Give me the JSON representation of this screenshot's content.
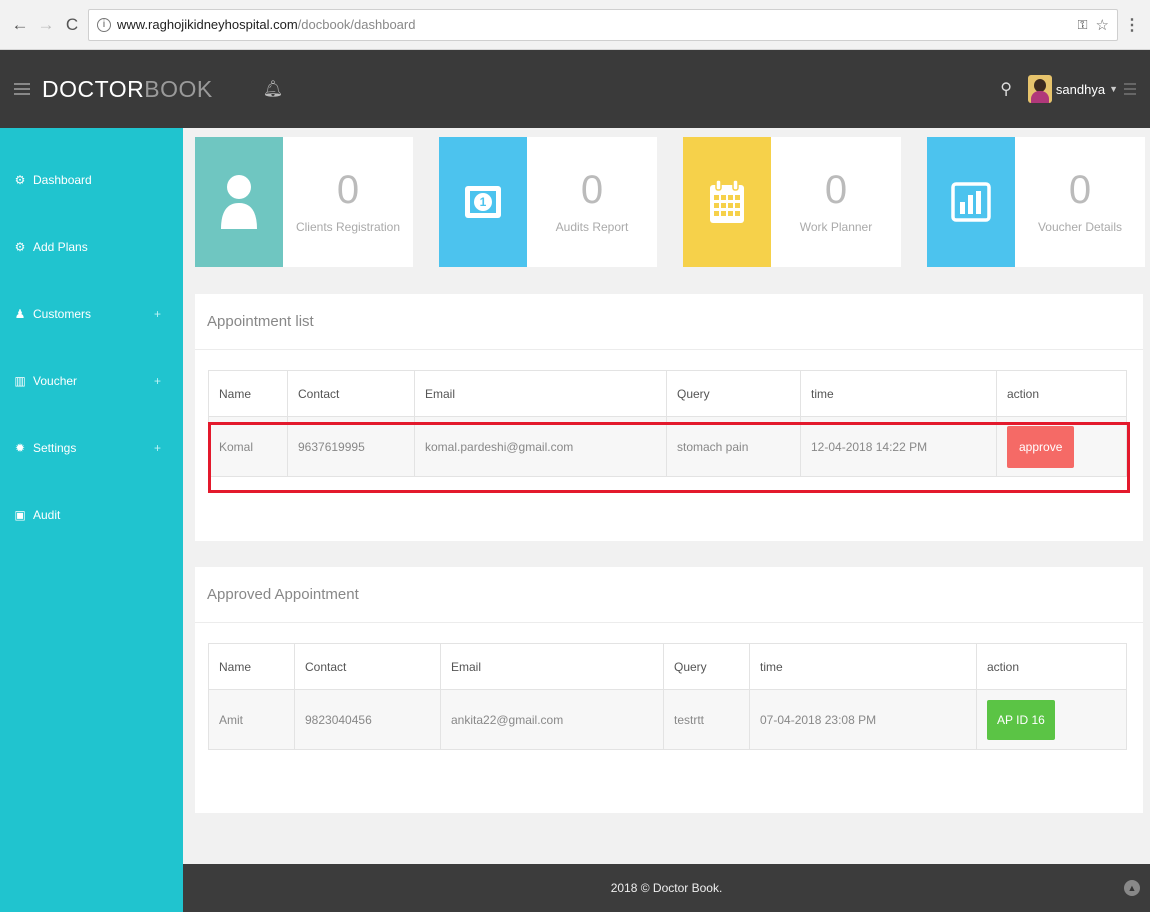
{
  "browser": {
    "url_host": "www.raghojikidneyhospital.com",
    "url_path": "/docbook/dashboard"
  },
  "header": {
    "brand_bold": "DOCTOR",
    "brand_light": "BOOK",
    "username": "sandhya"
  },
  "sidebar": {
    "items": [
      {
        "label": "Dashboard"
      },
      {
        "label": "Add Plans"
      },
      {
        "label": "Customers",
        "expand": "+"
      },
      {
        "label": "Voucher",
        "expand": "+"
      },
      {
        "label": "Settings",
        "expand": "+"
      },
      {
        "label": "Audit"
      }
    ]
  },
  "stats": [
    {
      "count": "0",
      "label": "Clients Registration",
      "color": "#6fc6c1",
      "icon": "user-icon"
    },
    {
      "count": "0",
      "label": "Audits Report",
      "color": "#4cc3ee",
      "icon": "money-icon"
    },
    {
      "count": "0",
      "label": "Work Planner",
      "color": "#f6d14a",
      "icon": "calendar-icon"
    },
    {
      "count": "0",
      "label": "Voucher Details",
      "color": "#4cc3ee",
      "icon": "bar-chart-icon"
    }
  ],
  "appointments": {
    "title": "Appointment list",
    "columns": [
      "Name",
      "Contact",
      "Email",
      "Query",
      "time",
      "action"
    ],
    "rows": [
      {
        "name": "Komal",
        "contact": "9637619995",
        "email": "komal.pardeshi@gmail.com",
        "query": "stomach pain",
        "time": "12-04-2018 14:22 PM",
        "action": "approve"
      }
    ]
  },
  "approved": {
    "title": "Approved Appointment",
    "columns": [
      "Name",
      "Contact",
      "Email",
      "Query",
      "time",
      "action"
    ],
    "rows": [
      {
        "name": "Amit",
        "contact": "9823040456",
        "email": "ankita22@gmail.com",
        "query": "testrtt",
        "time": "07-04-2018 23:08 PM",
        "action": "AP ID 16"
      }
    ]
  },
  "footer": {
    "text": "2018 © Doctor Book."
  },
  "colors": {
    "sidebar": "#20c4cf",
    "header": "#3a3a3a",
    "approve": "#f56a66",
    "ap_id": "#5bc445",
    "highlight": "#e3192c"
  }
}
